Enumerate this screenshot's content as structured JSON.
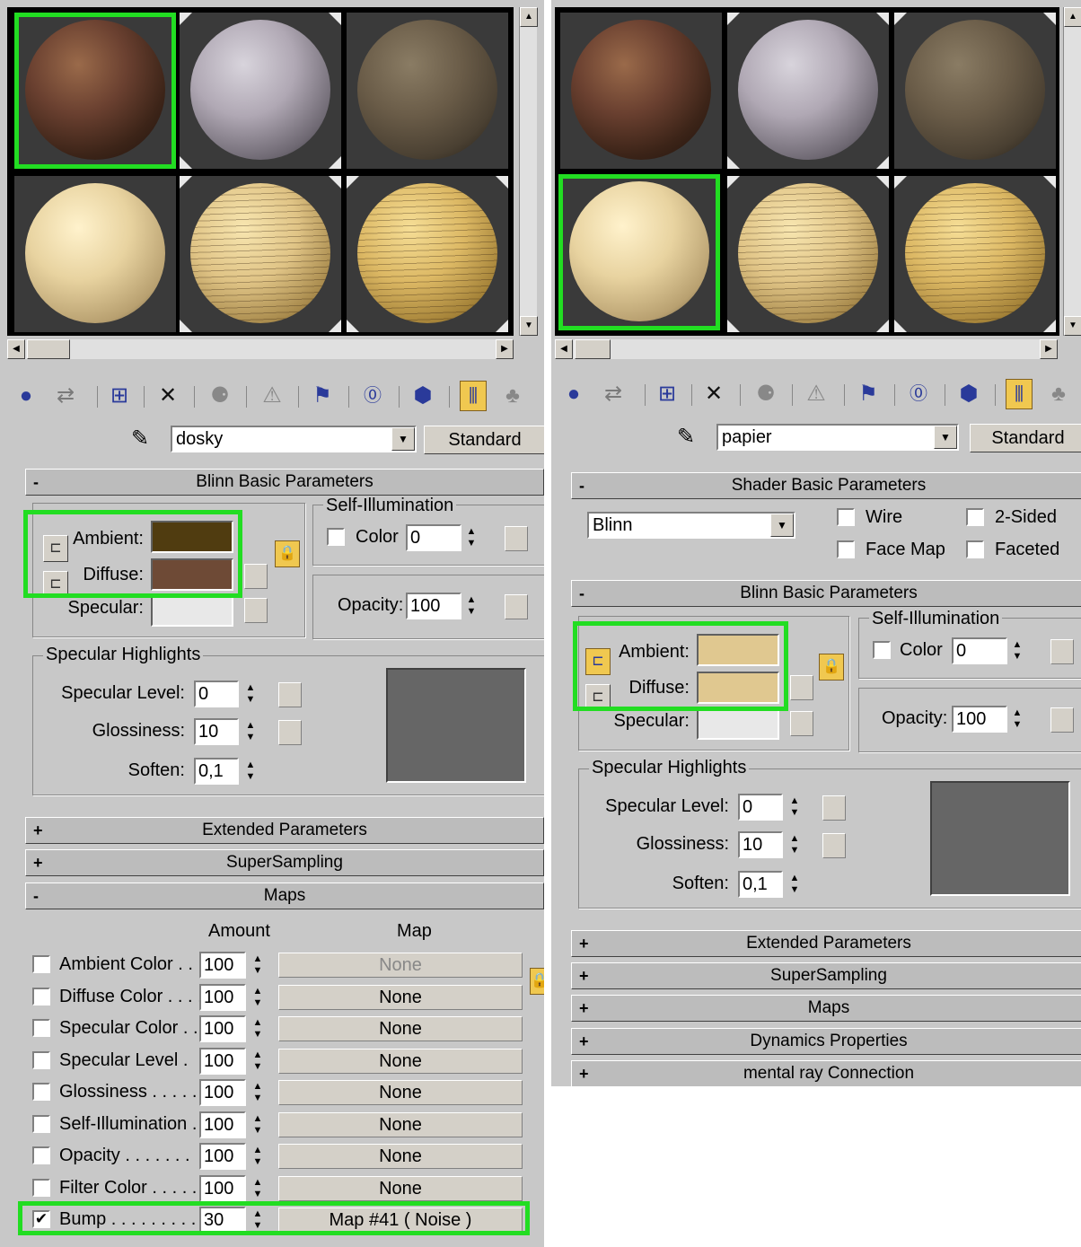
{
  "colors": {
    "highlight": "#22dd22",
    "ambient_left": "#503c10",
    "diffuse_left": "#6e4a36",
    "specular": "#e8e8e8",
    "ambient_right": "#e0c890",
    "diffuse_right": "#e0c890"
  },
  "toolbar_icons": [
    "get-material-icon",
    "put-to-scene-icon",
    "assign-material-icon",
    "reset-icon",
    "make-copy-icon",
    "make-unique-icon",
    "put-to-library-icon",
    "material-id-icon",
    "show-map-icon",
    "show-end-result-icon",
    "go-to-parent-icon"
  ],
  "left": {
    "material_name": "dosky",
    "type_button": "Standard",
    "blinn_rollup": "Blinn Basic Parameters",
    "ambient_label": "Ambient:",
    "diffuse_label": "Diffuse:",
    "specular_label": "Specular:",
    "self_illum_title": "Self-Illumination",
    "color_label": "Color",
    "color_value": "0",
    "opacity_label": "Opacity:",
    "opacity_value": "100",
    "spec_highlights_title": "Specular Highlights",
    "spec_level_label": "Specular Level:",
    "spec_level_value": "0",
    "glossiness_label": "Glossiness:",
    "glossiness_value": "10",
    "soften_label": "Soften:",
    "soften_value": "0,1",
    "extended_rollup": "Extended Parameters",
    "supersampling_rollup": "SuperSampling",
    "maps_rollup": "Maps",
    "maps_amount_header": "Amount",
    "maps_map_header": "Map",
    "maps": [
      {
        "label": "Ambient Color . . .",
        "amount": "100",
        "map": "None",
        "checked": ""
      },
      {
        "label": "Diffuse Color . . . .",
        "amount": "100",
        "map": "None",
        "checked": ""
      },
      {
        "label": "Specular Color . .",
        "amount": "100",
        "map": "None",
        "checked": ""
      },
      {
        "label": "Specular Level  .",
        "amount": "100",
        "map": "None",
        "checked": ""
      },
      {
        "label": "Glossiness . . . . .",
        "amount": "100",
        "map": "None",
        "checked": ""
      },
      {
        "label": "Self-Illumination .",
        "amount": "100",
        "map": "None",
        "checked": ""
      },
      {
        "label": "Opacity . . . . . . .",
        "amount": "100",
        "map": "None",
        "checked": ""
      },
      {
        "label": "Filter Color  . . . . .",
        "amount": "100",
        "map": "None",
        "checked": ""
      },
      {
        "label": "Bump . . . . . . . . .",
        "amount": "30",
        "map": "Map #41  ( Noise )",
        "checked": "✔"
      }
    ]
  },
  "right": {
    "material_name": "papier",
    "type_button": "Standard",
    "shader_rollup": "Shader Basic Parameters",
    "shader_value": "Blinn",
    "wire_label": "Wire",
    "two_sided_label": "2-Sided",
    "face_map_label": "Face Map",
    "faceted_label": "Faceted",
    "blinn_rollup": "Blinn Basic Parameters",
    "ambient_label": "Ambient:",
    "diffuse_label": "Diffuse:",
    "specular_label": "Specular:",
    "self_illum_title": "Self-Illumination",
    "color_label": "Color",
    "color_value": "0",
    "opacity_label": "Opacity:",
    "opacity_value": "100",
    "spec_highlights_title": "Specular Highlights",
    "spec_level_label": "Specular Level:",
    "spec_level_value": "0",
    "glossiness_label": "Glossiness:",
    "glossiness_value": "10",
    "soften_label": "Soften:",
    "soften_value": "0,1",
    "rollups": [
      "Extended Parameters",
      "SuperSampling",
      "Maps",
      "Dynamics Properties",
      "mental ray Connection"
    ]
  }
}
